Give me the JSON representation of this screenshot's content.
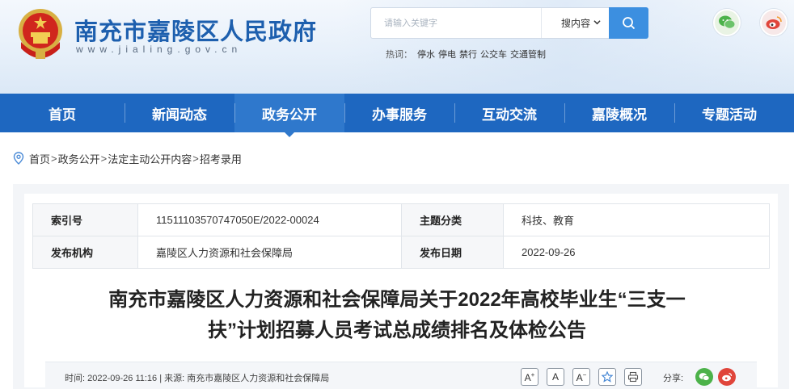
{
  "header": {
    "site_title": "南充市嘉陵区人民政府",
    "site_url": "www.jialing.gov.cn",
    "emblem_icon": "national-emblem-icon"
  },
  "search": {
    "placeholder": "请输入关键字",
    "scope": "搜内容",
    "hot_label": "热词：",
    "hot_words": [
      "停水",
      "停电",
      "禁行",
      "公交车",
      "交通管制"
    ]
  },
  "social": {
    "wechat": "wechat-icon",
    "weibo": "weibo-icon"
  },
  "nav": {
    "items": [
      {
        "label": "首页"
      },
      {
        "label": "新闻动态"
      },
      {
        "label": "政务公开"
      },
      {
        "label": "办事服务"
      },
      {
        "label": "互动交流"
      },
      {
        "label": "嘉陵概况"
      },
      {
        "label": "专题活动"
      }
    ],
    "active_index": 2
  },
  "breadcrumb": [
    "首页",
    "政务公开",
    "法定主动公开内容",
    "招考录用"
  ],
  "meta": {
    "index_label": "索引号",
    "index_value": "11511103570747050E/2022-00024",
    "category_label": "主题分类",
    "category_value": "科技、教育",
    "org_label": "发布机构",
    "org_value": "嘉陵区人力资源和社会保障局",
    "date_label": "发布日期",
    "date_value": "2022-09-26"
  },
  "article": {
    "title_line1": "南充市嘉陵区人力资源和社会保障局关于2022年高校毕业生“三支一",
    "title_line2": "扶”计划招募人员考试总成绩排名及体检公告",
    "time_label": "时间:",
    "time_value": "2022-09-26 11:16",
    "source_label": "来源:",
    "source_value": "南充市嘉陵区人力资源和社会保障局",
    "share_label": "分享:"
  },
  "colors": {
    "primary": "#1e67c0",
    "title": "#1d5fae",
    "search_btn": "#3c8fe0"
  }
}
